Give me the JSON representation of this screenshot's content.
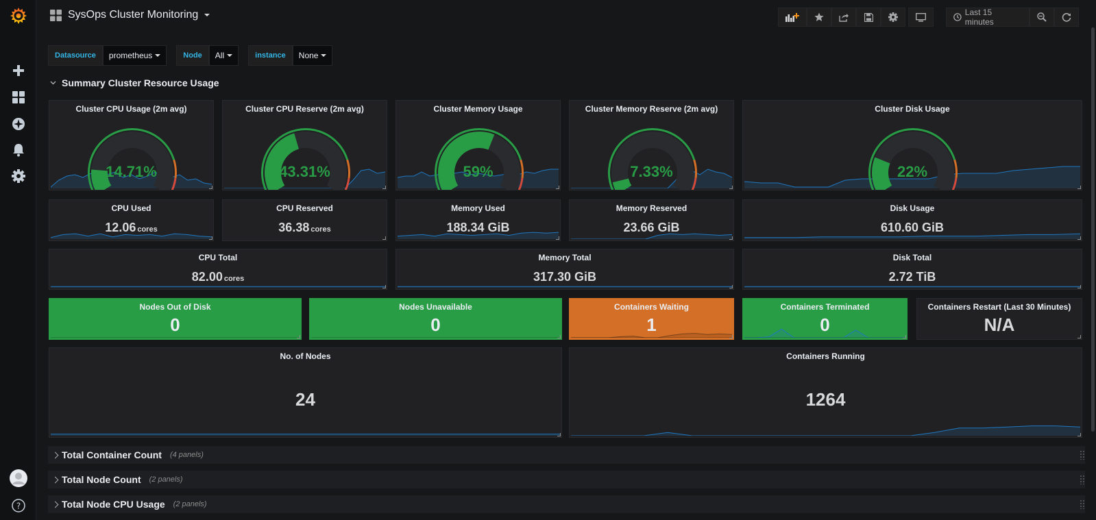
{
  "dashboard": {
    "title": "SysOps Cluster Monitoring"
  },
  "toolbar": {
    "time_range": "Last 15 minutes"
  },
  "variables": [
    {
      "label": "Datasource",
      "value": "prometheus"
    },
    {
      "label": "Node",
      "value": "All"
    },
    {
      "label": "instance",
      "value": "None"
    }
  ],
  "summary_row": {
    "title": "Summary Cluster Resource Usage"
  },
  "gauges": [
    {
      "title": "Cluster CPU Usage (2m avg)",
      "value": "14.71%",
      "fraction": 0.1471
    },
    {
      "title": "Cluster CPU Reserve (2m avg)",
      "value": "43.31%",
      "fraction": 0.4331
    },
    {
      "title": "Cluster Memory Usage",
      "value": "59%",
      "fraction": 0.59
    },
    {
      "title": "Cluster Memory Reserve (2m avg)",
      "value": "7.33%",
      "fraction": 0.0733
    },
    {
      "title": "Cluster Disk Usage",
      "value": "22%",
      "fraction": 0.22
    }
  ],
  "stats": [
    {
      "title": "CPU Used",
      "value": "12.06",
      "unit": "cores"
    },
    {
      "title": "CPU Reserved",
      "value": "36.38",
      "unit": "cores"
    },
    {
      "title": "Memory Used",
      "value": "188.34 GiB",
      "unit": ""
    },
    {
      "title": "Memory Reserved",
      "value": "23.66 GiB",
      "unit": ""
    },
    {
      "title": "Disk Usage",
      "value": "610.60 GiB",
      "unit": ""
    }
  ],
  "totals": [
    {
      "title": "CPU Total",
      "value": "82.00",
      "unit": "cores"
    },
    {
      "title": "Memory Total",
      "value": "317.30 GiB",
      "unit": ""
    },
    {
      "title": "Disk Total",
      "value": "2.72 TiB",
      "unit": ""
    }
  ],
  "status": [
    {
      "title": "Nodes Out of Disk",
      "value": "0"
    },
    {
      "title": "Nodes Unavailable",
      "value": "0"
    },
    {
      "title": "Containers Waiting",
      "value": "1"
    },
    {
      "title": "Containers Terminated",
      "value": "0"
    },
    {
      "title": "Containers Restart (Last 30 Minutes)",
      "value": "N/A"
    }
  ],
  "counts": [
    {
      "title": "No. of Nodes",
      "value": "24"
    },
    {
      "title": "Containers Running",
      "value": "1264"
    }
  ],
  "collapsed_rows": [
    {
      "title": "Total Container Count",
      "panels": "(4 panels)"
    },
    {
      "title": "Total Node Count",
      "panels": "(2 panels)"
    },
    {
      "title": "Total Node CPU Usage",
      "panels": "(2 panels)"
    }
  ],
  "colors": {
    "green": "#299c46",
    "orange": "#d46f27",
    "red": "#d44a3a",
    "blue": "#33b5e5",
    "spark_line": "#1f78c1",
    "spark_fill": "rgba(31,120,193,0.18)"
  },
  "icons": [
    "grafana-logo-icon",
    "plus-icon",
    "dashboards-icon",
    "explore-icon",
    "bell-icon",
    "gear-icon",
    "avatar",
    "help-icon",
    "grid-icon",
    "add-panel-icon",
    "star-icon",
    "share-icon",
    "save-icon",
    "settings-icon",
    "tv-icon",
    "clock-icon",
    "zoom-out-icon",
    "refresh-icon"
  ]
}
